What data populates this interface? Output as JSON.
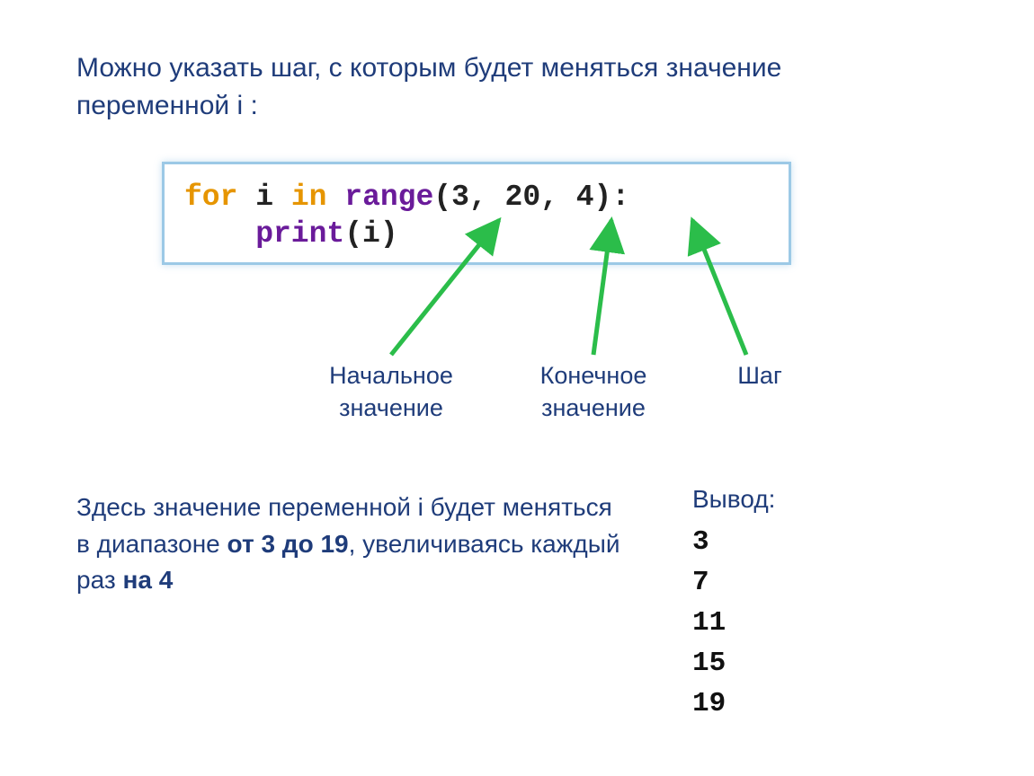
{
  "intro": "Можно указать шаг, с которым будет меняться значение переменной i :",
  "code": {
    "kw_for": "for",
    "var": " i ",
    "kw_in": "in",
    "sp": " ",
    "fn_range": "range",
    "args": "(3, 20, 4):",
    "fn_print": "print",
    "print_args": "(i)"
  },
  "labels": {
    "start": "Начальное значение",
    "end": "Конечное значение",
    "step": "Шаг"
  },
  "detail": {
    "p1": "Здесь значение переменной i будет меняться в диапазоне ",
    "b1": "от 3 до 19",
    "p2": ", увеличиваясь каждый раз ",
    "b2": "на 4"
  },
  "output": {
    "title": "Вывод:",
    "lines": "3\n7\n11\n15\n19"
  }
}
